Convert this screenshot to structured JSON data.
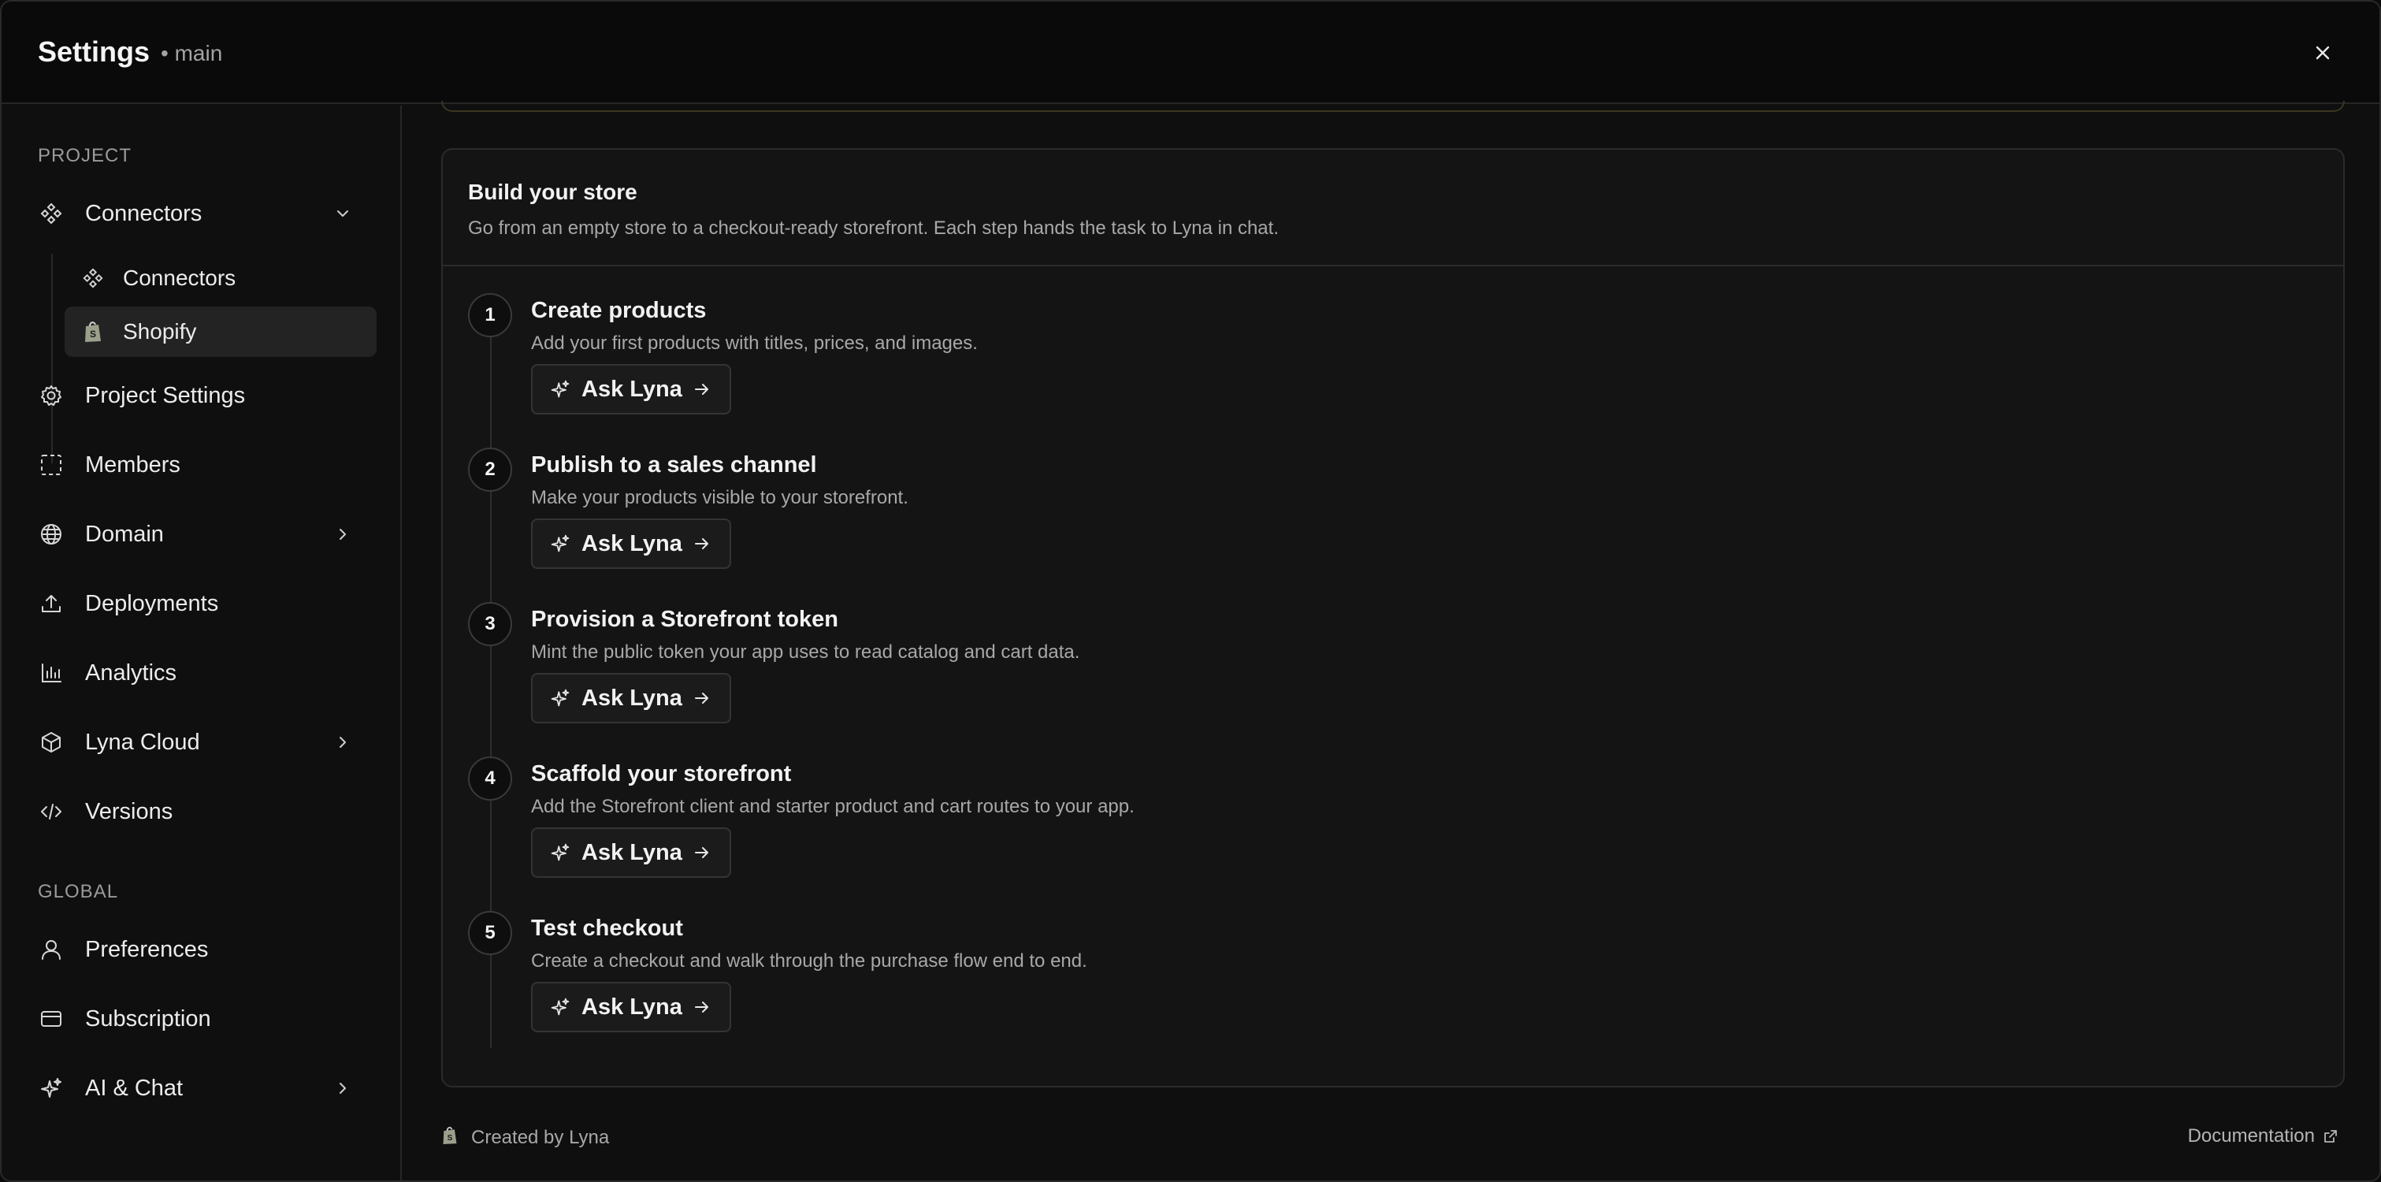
{
  "header": {
    "title": "Settings",
    "branch": "• main"
  },
  "sidebar": {
    "project_label": "PROJECT",
    "global_label": "GLOBAL",
    "connectors_group": "Connectors",
    "connectors_sub": "Connectors",
    "shopify_sub": "Shopify",
    "project_settings": "Project Settings",
    "members": "Members",
    "domain": "Domain",
    "deployments": "Deployments",
    "analytics": "Analytics",
    "lyna_cloud": "Lyna Cloud",
    "versions": "Versions",
    "preferences": "Preferences",
    "subscription": "Subscription",
    "ai_chat": "AI & Chat"
  },
  "card": {
    "title": "Build your store",
    "description": "Go from an empty store to a checkout-ready storefront. Each step hands the task to Lyna in chat."
  },
  "steps": [
    {
      "num": "1",
      "title": "Create products",
      "desc": "Add your first products with titles, prices, and images.",
      "button": "Ask Lyna"
    },
    {
      "num": "2",
      "title": "Publish to a sales channel",
      "desc": "Make your products visible to your storefront.",
      "button": "Ask Lyna"
    },
    {
      "num": "3",
      "title": "Provision a Storefront token",
      "desc": "Mint the public token your app uses to read catalog and cart data.",
      "button": "Ask Lyna"
    },
    {
      "num": "4",
      "title": "Scaffold your storefront",
      "desc": "Add the Storefront client and starter product and cart routes to your app.",
      "button": "Ask Lyna"
    },
    {
      "num": "5",
      "title": "Test checkout",
      "desc": "Create a checkout and walk through the purchase flow end to end.",
      "button": "Ask Lyna"
    }
  ],
  "footer": {
    "created_by": "Created by Lyna",
    "documentation": "Documentation"
  }
}
